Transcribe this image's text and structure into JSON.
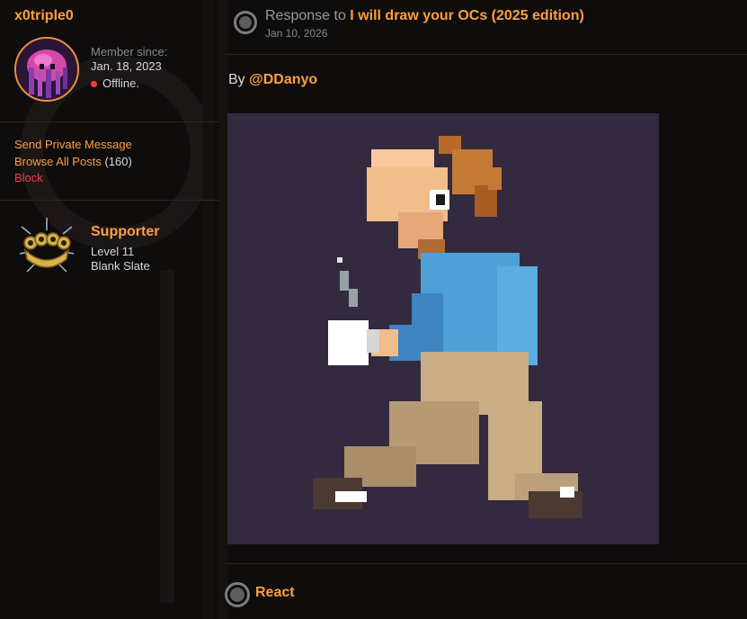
{
  "profile": {
    "username": "x0triple0",
    "member_since_label": "Member since:",
    "member_since_date": "Jan. 18, 2023",
    "status": "Offline.",
    "links": {
      "send_message": "Send Private Message",
      "browse_posts": "Browse All Posts",
      "post_count": "(160)",
      "block": "Block"
    },
    "rank": {
      "title": "Supporter",
      "level": "Level 11",
      "subtitle": "Blank Slate"
    }
  },
  "post": {
    "response_prefix": "Response to",
    "thread_title": "I will draw your OCs (2025 edition)",
    "date": "Jan 10, 2026",
    "by_label": "By",
    "artist": "@DDanyo",
    "react_label": "React"
  },
  "colors": {
    "accent": "#ff9f3f",
    "block": "#ff3b48",
    "offline_dot": "#ff3b30",
    "background": "#0f0c0c",
    "art_background": "#332a3f"
  }
}
